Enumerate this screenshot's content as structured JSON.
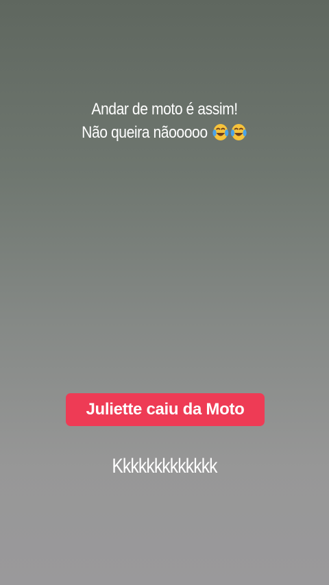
{
  "story": {
    "caption_line1": "Andar de moto é assim!",
    "caption_line2": "Não queira nãooooo",
    "emoji": "face-with-tears-of-joy-icon",
    "tag_label": "Juliette caiu da Moto",
    "comment": "Kkkkkkkkkkkkk"
  },
  "colors": {
    "tag_background": "#ee3b55",
    "text": "#ffffff",
    "background_top": "#5f675f",
    "background_bottom": "#9a999b"
  }
}
